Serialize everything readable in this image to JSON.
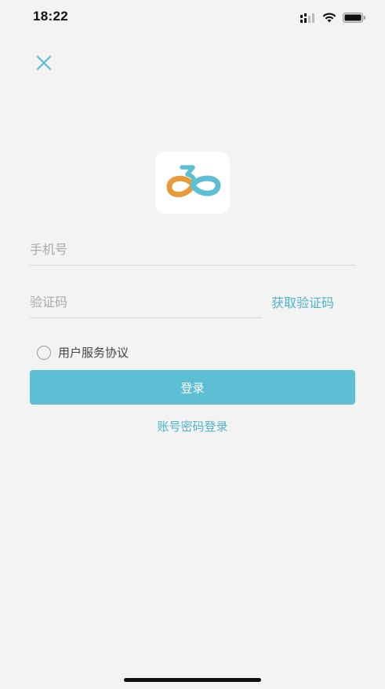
{
  "status_bar": {
    "time": "18:22",
    "icons": [
      "cellular-signal-icon",
      "wifi-icon",
      "battery-icon"
    ]
  },
  "header": {
    "close_icon": "close-icon"
  },
  "logo": {
    "icon": "app-logo-icon",
    "colors": {
      "orange": "#e79a3a",
      "teal": "#5cbfd4"
    }
  },
  "form": {
    "phone_placeholder": "手机号",
    "phone_value": "",
    "code_placeholder": "验证码",
    "code_value": "",
    "get_code_label": "获取验证码",
    "agreement_label": "用户服务协议",
    "agreement_checked": false,
    "login_label": "登录",
    "password_login_label": "账号密码登录"
  },
  "colors": {
    "accent": "#5cbfd4",
    "accent_text": "#4fb3c8",
    "background": "#f3f3f3"
  }
}
